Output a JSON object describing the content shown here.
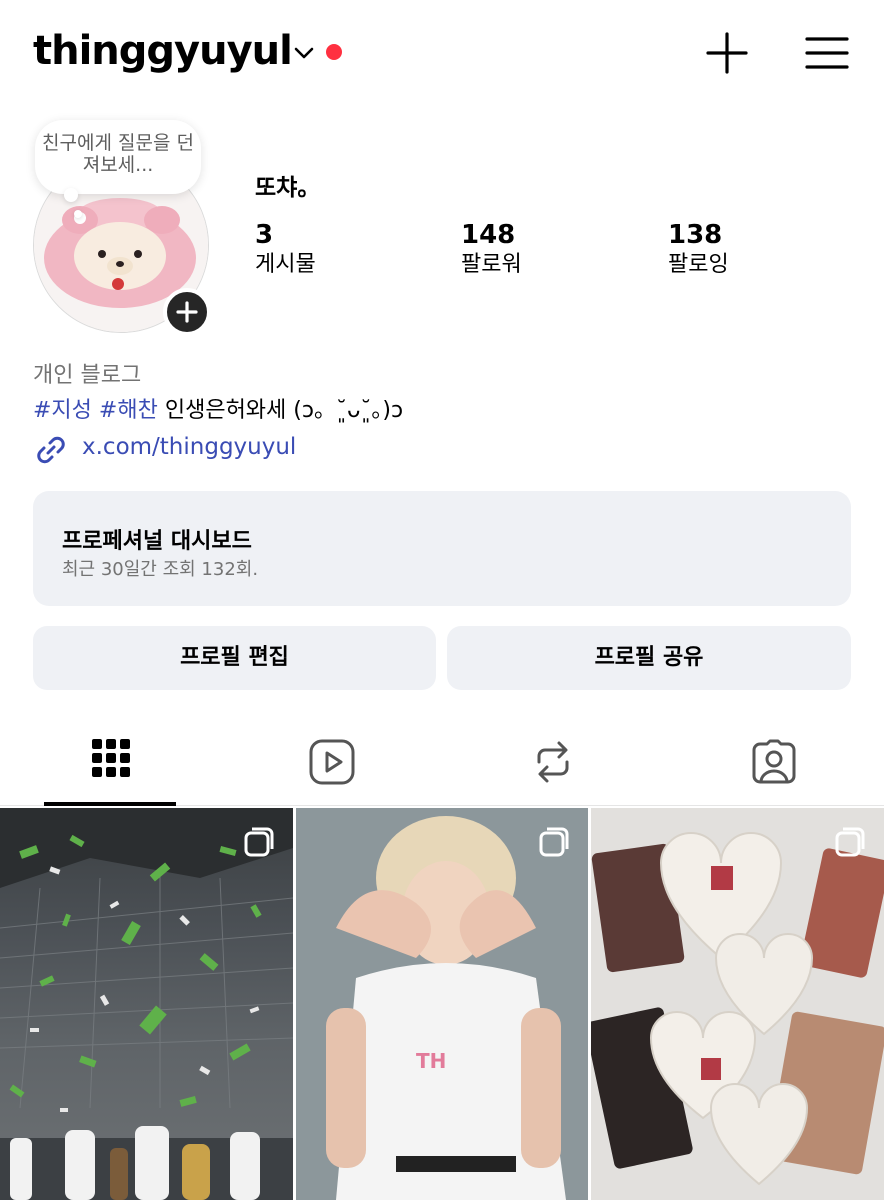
{
  "header": {
    "username": "thinggyuyul",
    "has_notification_dot": true,
    "accent_red": "#ff3040"
  },
  "note": {
    "placeholder": "친구에게 질문을 던져보세..."
  },
  "profile": {
    "display_name": "또챠。",
    "stats": [
      {
        "value": "3",
        "label": "게시물"
      },
      {
        "value": "148",
        "label": "팔로워"
      },
      {
        "value": "138",
        "label": "팔로잉"
      }
    ],
    "category": "개인 블로그",
    "bio": {
      "tags": [
        "#지성",
        "#해찬"
      ],
      "text": "인생은허와세 (ɔ。˘͈ᴗ˘͈。)ɔ"
    },
    "link": "x.com/thinggyuyul",
    "link_color": "#3a4cb4"
  },
  "dashboard": {
    "title": "프로페셔널 대시보드",
    "subtitle": "최근 30일간 조회 132회."
  },
  "actions": {
    "edit_label": "프로필 편집",
    "share_label": "프로필 공유"
  },
  "tabs": [
    {
      "icon": "grid-icon",
      "active": true
    },
    {
      "icon": "reels-icon",
      "active": false
    },
    {
      "icon": "reposts-icon",
      "active": false
    },
    {
      "icon": "tagged-icon",
      "active": false
    }
  ],
  "posts": [
    {
      "icon": "multi-post-icon"
    },
    {
      "icon": "multi-post-icon"
    },
    {
      "icon": "multi-post-icon"
    }
  ]
}
